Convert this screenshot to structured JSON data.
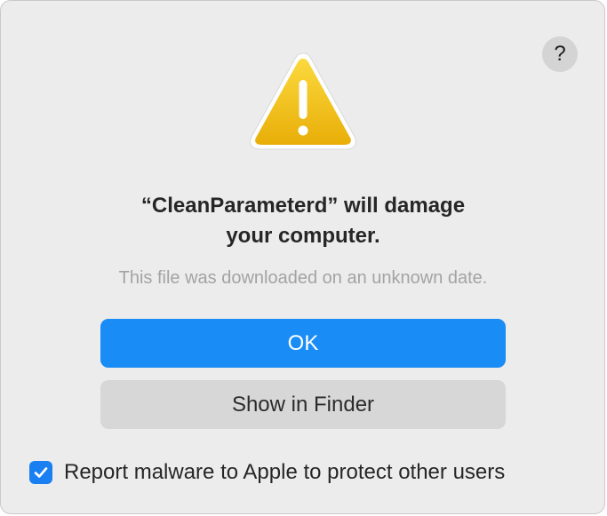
{
  "dialog": {
    "help_label": "?",
    "title_line1": "“CleanParameterd” will damage",
    "title_line2": "your computer.",
    "subtitle": "This file was downloaded on an unknown date.",
    "ok_label": "OK",
    "show_in_finder_label": "Show in Finder",
    "report_checkbox": {
      "checked": true,
      "label": "Report malware to Apple to protect other users"
    },
    "icon": "warning-triangle-icon"
  },
  "colors": {
    "primary_button": "#1a8cf5",
    "secondary_button": "#d7d7d7",
    "warning_yellow": "#f5c518",
    "checkbox_blue": "#1a7ff0"
  }
}
